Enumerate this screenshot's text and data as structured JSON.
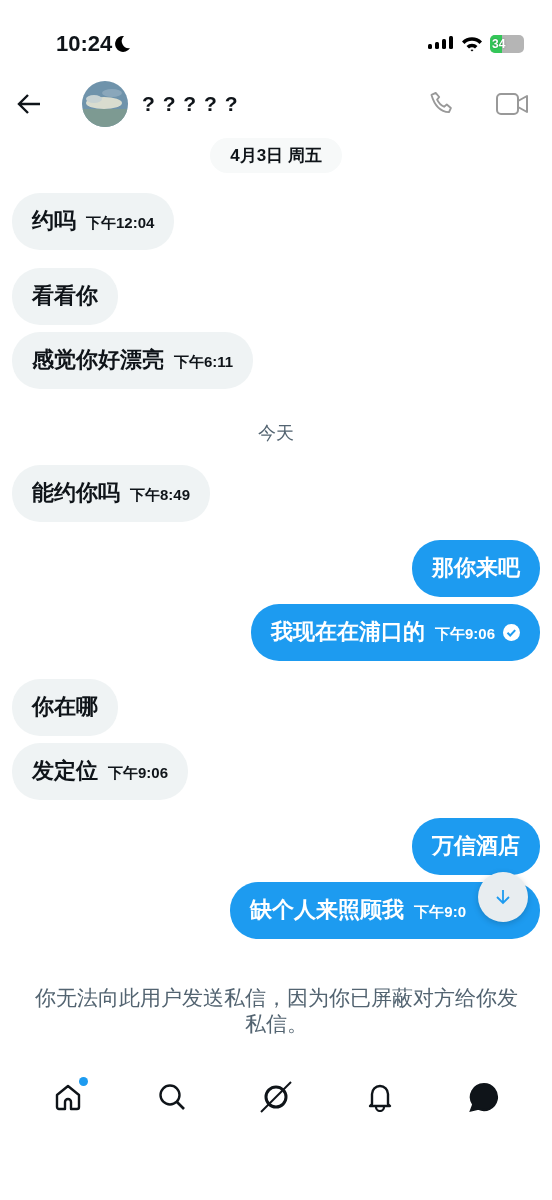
{
  "status_bar": {
    "time": "10:24",
    "battery": "34"
  },
  "header": {
    "name": "? ? ? ? ?"
  },
  "messages": [
    {
      "kind": "day",
      "text": "4月3日 周五"
    },
    {
      "kind": "received",
      "text": "约吗",
      "time": "下午12:04"
    },
    {
      "kind": "received",
      "text": "看看你"
    },
    {
      "kind": "received",
      "text": "感觉你好漂亮",
      "time": "下午6:11"
    },
    {
      "kind": "day",
      "text": "今天"
    },
    {
      "kind": "received",
      "text": "能约你吗",
      "time": "下午8:49"
    },
    {
      "kind": "sent",
      "text": "那你来吧"
    },
    {
      "kind": "sent",
      "text": "我现在在浦口的",
      "time": "下午9:06",
      "read": true
    },
    {
      "kind": "received",
      "text": "你在哪"
    },
    {
      "kind": "received",
      "text": "发定位",
      "time": "下午9:06"
    },
    {
      "kind": "sent",
      "text": "万信酒店"
    },
    {
      "kind": "sent",
      "text": "缺个人来照顾我",
      "time": "下午9:0",
      "covered": true
    }
  ],
  "notice": "你无法向此用户发送私信，因为你已屏蔽对方给你发私信。",
  "nav": [
    {
      "badge": true,
      "selected": false
    },
    {
      "badge": false,
      "selected": false
    },
    {
      "badge": false,
      "selected": false
    },
    {
      "badge": false,
      "selected": false
    },
    {
      "badge": false,
      "selected": true
    }
  ]
}
